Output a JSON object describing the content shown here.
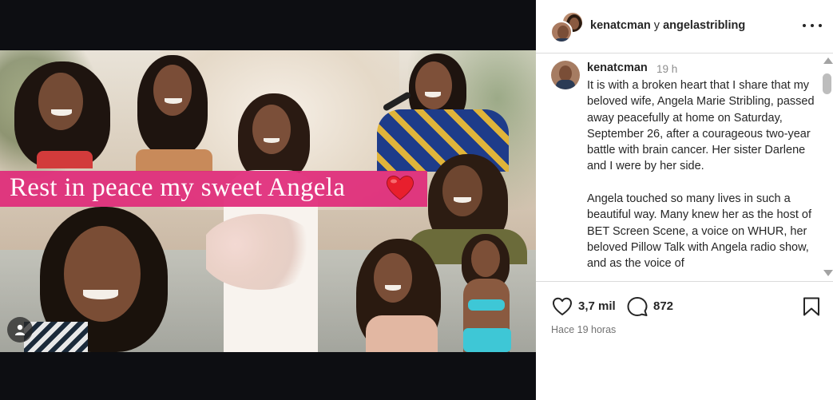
{
  "post": {
    "banner_text": "Rest in peace my sweet Angela",
    "heart_icon": "red-heart-emoji"
  },
  "header": {
    "user1": "kenatcman",
    "joiner": "y",
    "user2": "angelastribling",
    "more_icon": "more-horizontal-icon"
  },
  "caption": {
    "username": "kenatcman",
    "time": "19 h",
    "paragraph1": "It is with a broken heart that I share that my beloved wife, Angela Marie Stribling, passed away peacefully at home on Saturday, September 26, after a courageous two-year battle with brain cancer. Her sister Darlene and I were by her side.",
    "paragraph2": "Angela touched so many lives in such a beautiful way. Many knew her as the host of BET Screen Scene, a voice on WHUR, her beloved Pillow Talk with Angela radio show, and as the voice of"
  },
  "actions": {
    "likes": "3,7 mil",
    "comments": "872",
    "posted": "Hace 19 horas"
  },
  "colors": {
    "banner": "#e02a7a",
    "text": "#262626",
    "muted": "#8e8e8e"
  }
}
